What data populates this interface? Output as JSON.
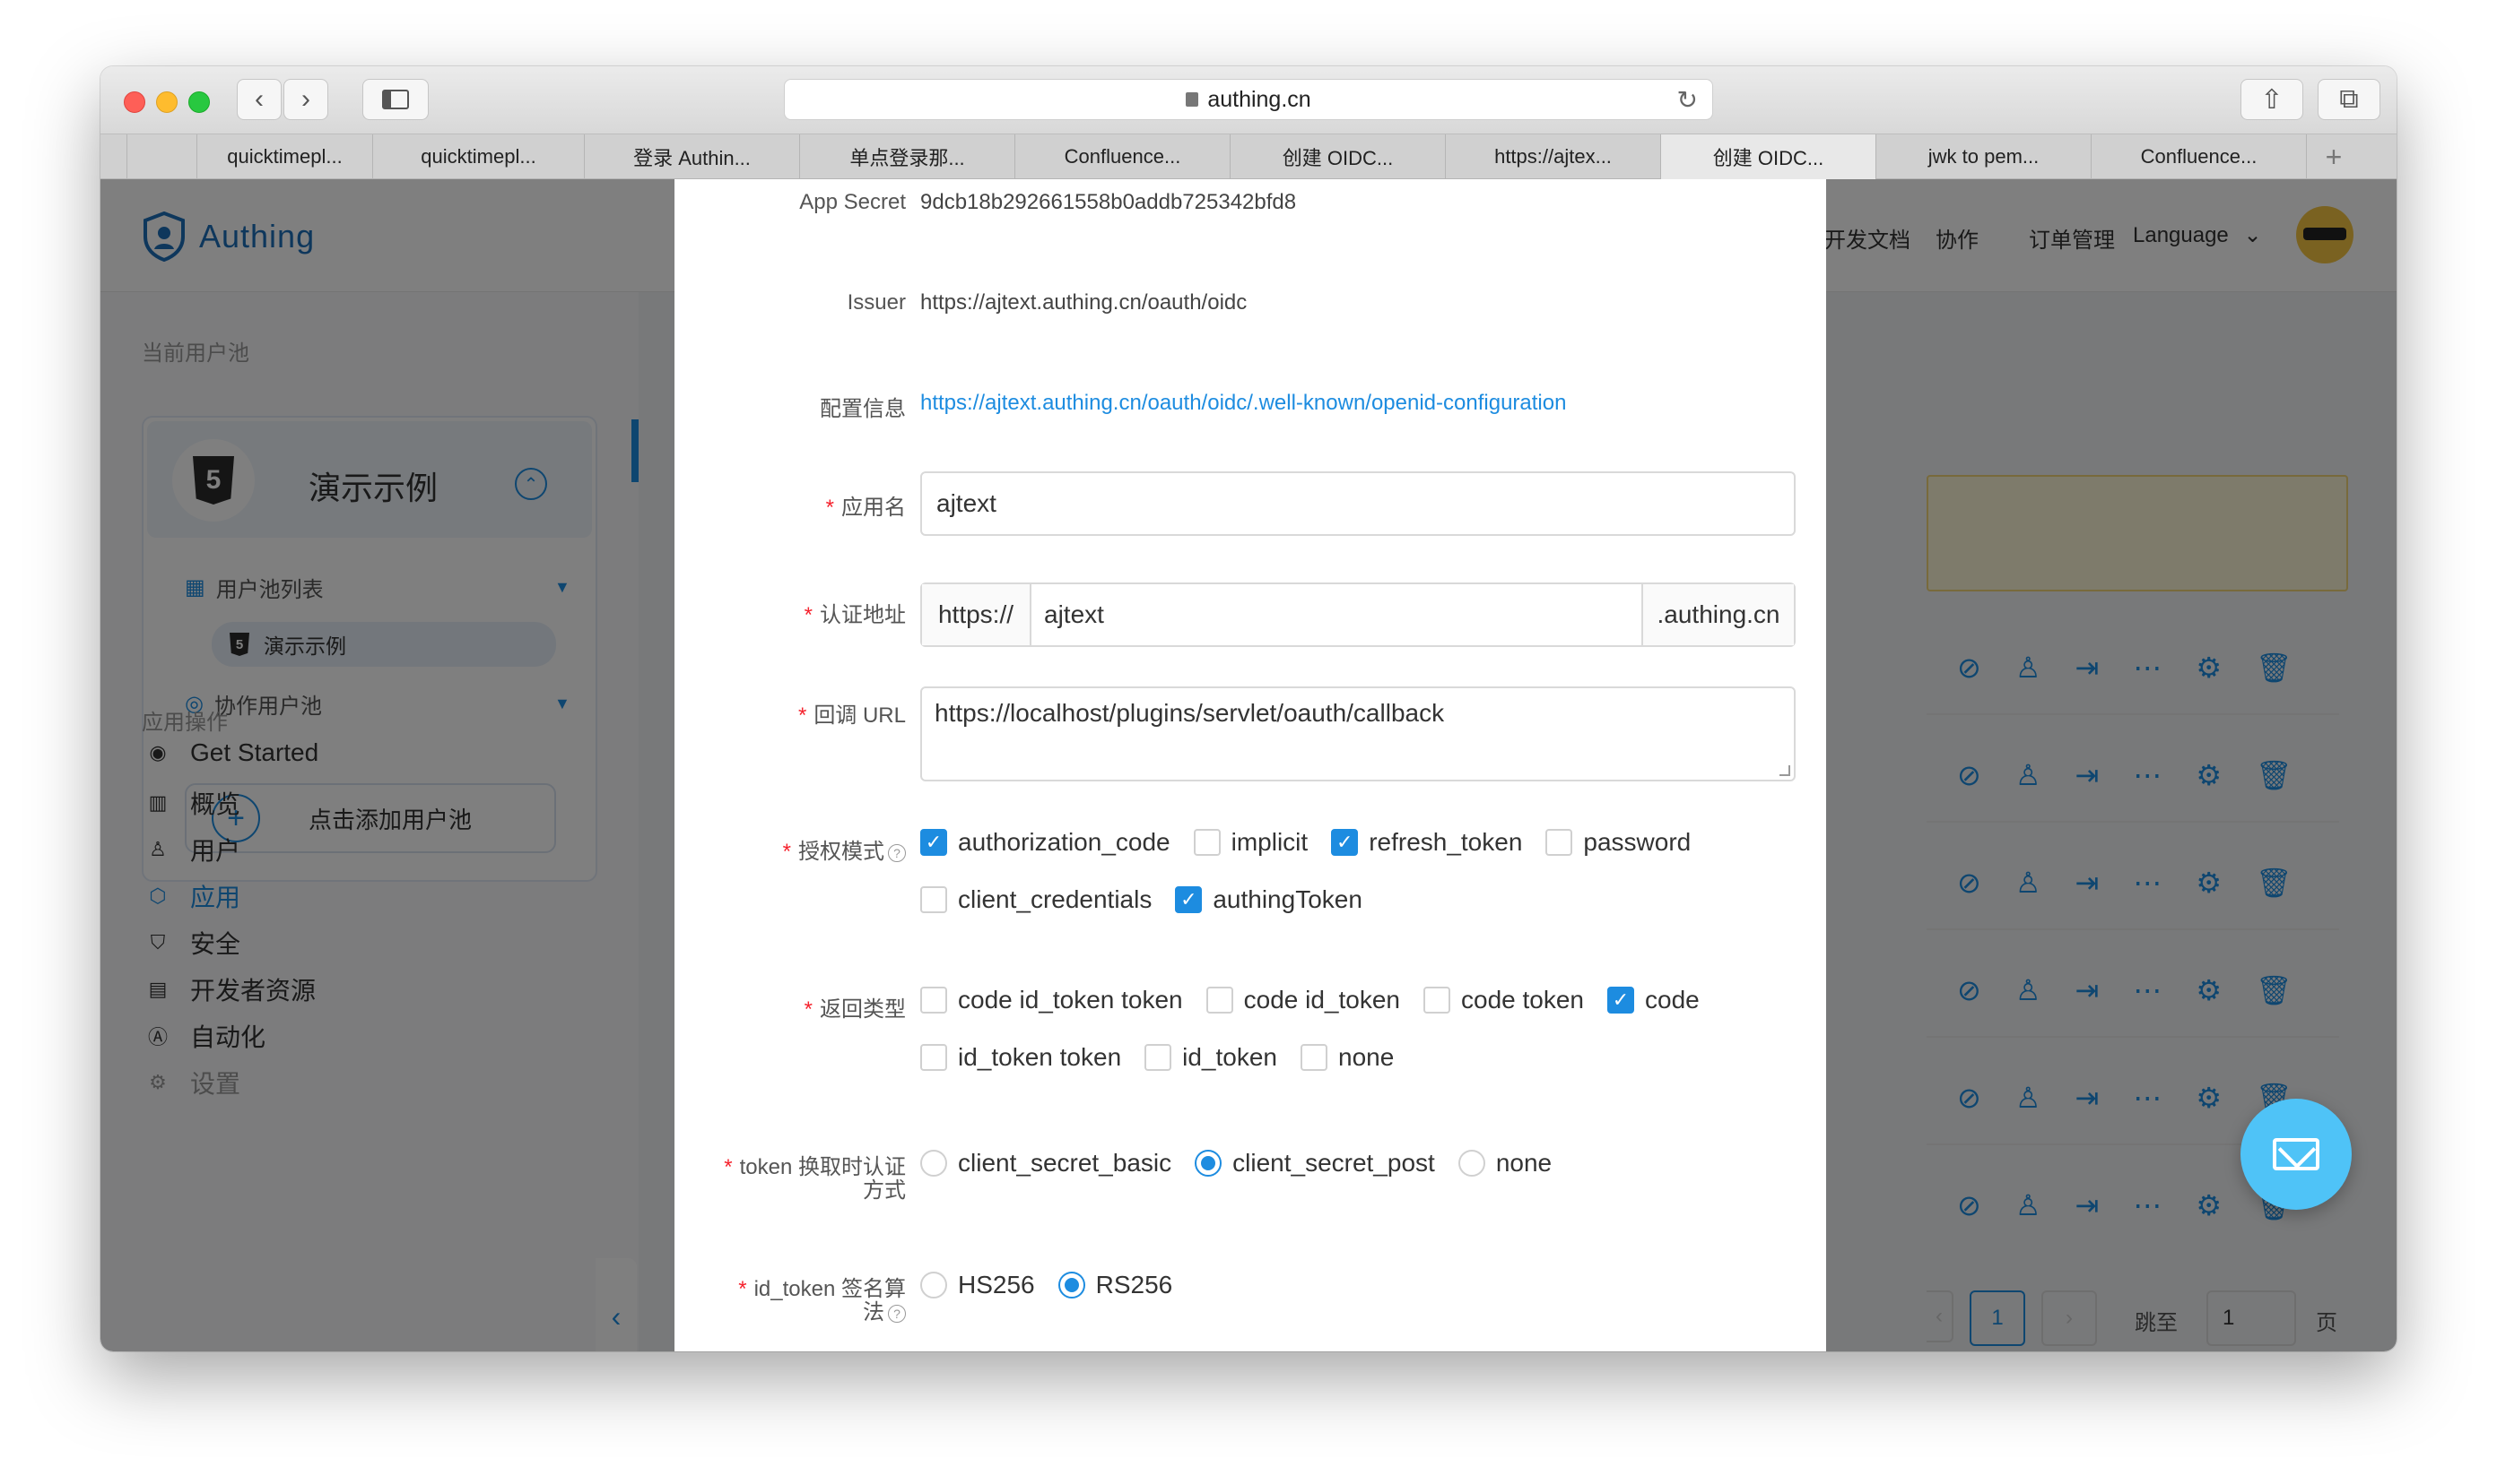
{
  "browser": {
    "url": "authing.cn",
    "tabs": [
      "quicktimepl...",
      "quicktimepl...",
      "登录 Authin...",
      "单点登录那...",
      "Confluence...",
      "创建 OIDC...",
      "https://ajtex...",
      "创建 OIDC...",
      "jwk to pem...",
      "Confluence..."
    ],
    "active_tab_index": 7
  },
  "header": {
    "brand": "Authing",
    "links": [
      "开发文档",
      "协作",
      "订单管理"
    ],
    "language": "Language"
  },
  "sidebar": {
    "current_pool_title": "当前用户池",
    "pool_name": "演示示例",
    "pool_list_label": "用户池列表",
    "pool_list_item": "演示示例",
    "collab_pool_label": "协作用户池",
    "add_pool_label": "点击添加用户池",
    "ops_title": "应用操作",
    "menu": [
      "Get Started",
      "概览",
      "用户",
      "应用",
      "安全",
      "开发者资源",
      "自动化",
      "设置"
    ],
    "active_menu_index": 3
  },
  "pagination": {
    "page": "1",
    "jump_label": "跳至",
    "jump_value": "1",
    "page_suffix": "页"
  },
  "modal": {
    "app_secret_label": "App Secret",
    "app_secret": "9dcb18b292661558b0addb725342bfd8",
    "issuer_label": "Issuer",
    "issuer": "https://ajtext.authing.cn/oauth/oidc",
    "config_label": "配置信息",
    "config_url": "https://ajtext.authing.cn/oauth/oidc/.well-known/openid-configuration",
    "app_name_label": "应用名",
    "app_name": "ajtext",
    "auth_addr_label": "认证地址",
    "auth_prefix": "https://",
    "auth_domain": "ajtext",
    "auth_suffix": ".authing.cn",
    "callback_label": "回调 URL",
    "callback_url": "https://localhost/plugins/servlet/oauth/callback",
    "grant_label": "授权模式",
    "grant_types": [
      {
        "label": "authorization_code",
        "checked": true
      },
      {
        "label": "implicit",
        "checked": false
      },
      {
        "label": "refresh_token",
        "checked": true
      },
      {
        "label": "password",
        "checked": false
      },
      {
        "label": "client_credentials",
        "checked": false
      },
      {
        "label": "authingToken",
        "checked": true
      }
    ],
    "response_label": "返回类型",
    "response_types": [
      {
        "label": "code id_token token",
        "checked": false
      },
      {
        "label": "code id_token",
        "checked": false
      },
      {
        "label": "code token",
        "checked": false
      },
      {
        "label": "code",
        "checked": true
      },
      {
        "label": "id_token token",
        "checked": false
      },
      {
        "label": "id_token",
        "checked": false
      },
      {
        "label": "none",
        "checked": false
      }
    ],
    "token_auth_label_1": "token 换取时认证",
    "token_auth_label_2": "方式",
    "token_auth_methods": [
      {
        "label": "client_secret_basic",
        "selected": false
      },
      {
        "label": "client_secret_post",
        "selected": true
      },
      {
        "label": "none",
        "selected": false
      }
    ],
    "sign_label_1": "id_token 签名算",
    "sign_label_2": "法",
    "sign_algs": [
      {
        "label": "HS256",
        "selected": false
      },
      {
        "label": "RS256",
        "selected": true
      }
    ]
  },
  "colors": {
    "primary": "#1d8ce0",
    "required": "#f5222d",
    "fab": "#4fc3f7"
  }
}
